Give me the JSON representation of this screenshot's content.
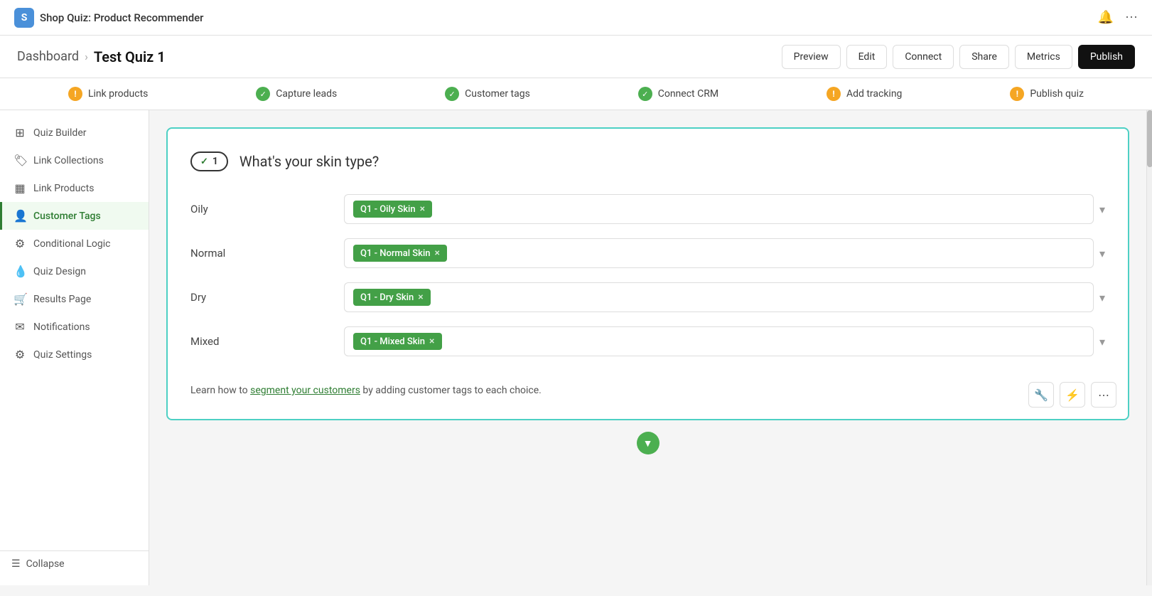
{
  "app": {
    "name": "Shop Quiz: Product Recommender",
    "logo_letter": "S"
  },
  "header": {
    "breadcrumb_dashboard": "Dashboard",
    "quiz_title": "Test Quiz 1",
    "buttons": {
      "preview": "Preview",
      "edit": "Edit",
      "connect": "Connect",
      "share": "Share",
      "metrics": "Metrics",
      "publish": "Publish"
    }
  },
  "steps": [
    {
      "label": "Link products",
      "status": "warn"
    },
    {
      "label": "Capture leads",
      "status": "ok"
    },
    {
      "label": "Customer tags",
      "status": "ok"
    },
    {
      "label": "Connect CRM",
      "status": "ok"
    },
    {
      "label": "Add tracking",
      "status": "warn"
    },
    {
      "label": "Publish quiz",
      "status": "warn"
    }
  ],
  "sidebar": {
    "items": [
      {
        "id": "quiz-builder",
        "label": "Quiz Builder",
        "icon": "⊞"
      },
      {
        "id": "link-collections",
        "label": "Link Collections",
        "icon": "🏷"
      },
      {
        "id": "link-products",
        "label": "Link Products",
        "icon": "▦"
      },
      {
        "id": "customer-tags",
        "label": "Customer Tags",
        "icon": "👤",
        "active": true
      },
      {
        "id": "conditional-logic",
        "label": "Conditional Logic",
        "icon": "⚙"
      },
      {
        "id": "quiz-design",
        "label": "Quiz Design",
        "icon": "💧"
      },
      {
        "id": "results-page",
        "label": "Results Page",
        "icon": "🛒"
      },
      {
        "id": "notifications",
        "label": "Notifications",
        "icon": "✉"
      },
      {
        "id": "quiz-settings",
        "label": "Quiz Settings",
        "icon": "⚙"
      }
    ],
    "collapse_label": "Collapse"
  },
  "quiz": {
    "question_number": "1",
    "question_text": "What's your skin type?",
    "answers": [
      {
        "label": "Oily",
        "tag": "Q1 - Oily Skin"
      },
      {
        "label": "Normal",
        "tag": "Q1 - Normal Skin"
      },
      {
        "label": "Dry",
        "tag": "Q1 - Dry Skin"
      },
      {
        "label": "Mixed",
        "tag": "Q1 - Mixed Skin"
      }
    ],
    "footer_note_prefix": "Learn how to ",
    "footer_note_link": "segment your customers",
    "footer_note_suffix": " by adding customer tags to each choice."
  },
  "toolbar": {
    "wrench": "🔧",
    "share": "⚡",
    "more": "⋯"
  }
}
